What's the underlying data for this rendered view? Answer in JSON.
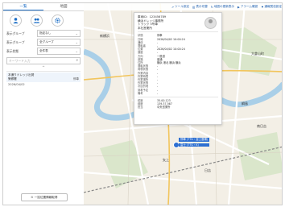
{
  "sidebar": {
    "tabs": [
      "一覧",
      "地図"
    ],
    "tools": [
      {
        "icon": "person-icon",
        "label": ""
      },
      {
        "icon": "people-icon",
        "label": ""
      },
      {
        "icon": "gear-icon",
        "label": ""
      }
    ],
    "filters": [
      {
        "label": "表示グループ",
        "value": "指定なし"
      },
      {
        "label": "表示グループ",
        "value": "全グループ"
      },
      {
        "label": "表示状態",
        "value": "全件表"
      }
    ],
    "search_placeholder": "キーワード入力",
    "list": [
      {
        "title": "本通りドレッジ出発",
        "name": "警察署",
        "status": "停車"
      }
    ],
    "sub_text": "2026/04/02",
    "bottom_button": "一括位置情報取得"
  },
  "toolbar": {
    "buttons": [
      "ツール設定",
      "表示切替",
      "地図の更新表示",
      "アラーム確認",
      "通報受信設定"
    ]
  },
  "map": {
    "labels": [
      "大倉山町",
      "綱島",
      "南日吉",
      "日吉",
      "矢上",
      "新横浜"
    ],
    "markers": [
      {
        "text": "停車 (TTG・富士鹿場)"
      },
      {
        "text": "富士 (TTG・K)"
      }
    ],
    "colors": {
      "water": "#a9cfe8",
      "road": "#ffffff",
      "land": "#f3efe6",
      "green": "#cfe3bf",
      "marker": "#2d6fd1"
    }
  },
  "popup": {
    "header": [
      "車両ID：123456789",
      "横浜ドレッジ事務所",
      "トラック 5号車",
      "本社営業所"
    ],
    "rows": [
      {
        "k": "状態",
        "v": "停車"
      },
      {
        "k": "日時",
        "v": "2026/04/02 10:00:24"
      },
      {
        "k": "通信",
        "v": "-"
      },
      {
        "k": "運転者",
        "v": "-"
      },
      {
        "k": "位置",
        "v": "2026/04/02 10:00:24"
      },
      {
        "k": "速度",
        "v": "-"
      },
      {
        "k": "方向",
        "v": "一般道"
      },
      {
        "k": "道路",
        "v": "普通"
      },
      {
        "k": "住所",
        "v": "横浜 港北 横浜 横浜"
      },
      {
        "k": "運転状態",
        "v": "-"
      },
      {
        "k": "荷物状態",
        "v": "-"
      },
      {
        "k": "作業内容",
        "v": "-"
      },
      {
        "k": "作業時間",
        "v": "-"
      },
      {
        "k": "作業場所",
        "v": "-"
      },
      {
        "k": "作業状態",
        "v": "-"
      },
      {
        "k": "次目的地",
        "v": "-"
      },
      {
        "k": "到着予定",
        "v": "-"
      },
      {
        "k": "備考",
        "v": "-"
      }
    ],
    "footer": [
      {
        "k": "緯度",
        "v": "35.00.123"
      },
      {
        "k": "経度",
        "v": "139.37.567"
      },
      {
        "k": "担当",
        "v": "中央営業所"
      }
    ]
  }
}
